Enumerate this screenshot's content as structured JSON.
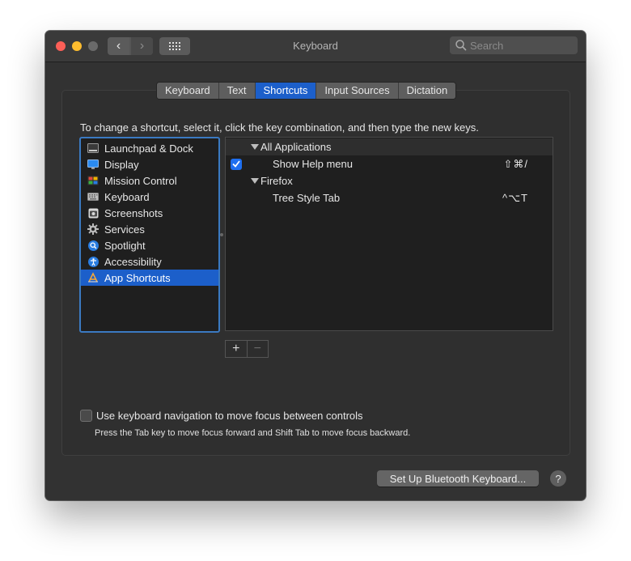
{
  "window": {
    "title": "Keyboard"
  },
  "toolbar": {
    "back_label": "‹",
    "forward_label": "›",
    "search_placeholder": "Search"
  },
  "tabs": [
    {
      "label": "Keyboard",
      "active": false
    },
    {
      "label": "Text",
      "active": false
    },
    {
      "label": "Shortcuts",
      "active": true
    },
    {
      "label": "Input Sources",
      "active": false
    },
    {
      "label": "Dictation",
      "active": false
    }
  ],
  "instruction": "To change a shortcut, select it, click the key combination, and then type the new keys.",
  "categories": [
    {
      "label": "Launchpad & Dock",
      "icon": "launchpad-dock-icon"
    },
    {
      "label": "Display",
      "icon": "display-icon"
    },
    {
      "label": "Mission Control",
      "icon": "mission-control-icon"
    },
    {
      "label": "Keyboard",
      "icon": "keyboard-icon"
    },
    {
      "label": "Screenshots",
      "icon": "screenshots-icon"
    },
    {
      "label": "Services",
      "icon": "gear-icon"
    },
    {
      "label": "Spotlight",
      "icon": "search-icon"
    },
    {
      "label": "Accessibility",
      "icon": "accessibility-icon"
    },
    {
      "label": "App Shortcuts",
      "icon": "app-store-icon",
      "selected": true
    }
  ],
  "shortcuts": {
    "groups": [
      {
        "label": "All Applications",
        "items": [
          {
            "label": "Show Help menu",
            "keys": "⇧⌘/",
            "checked": true
          }
        ]
      },
      {
        "label": "Firefox",
        "items": [
          {
            "label": "Tree Style Tab",
            "keys": "^⌥T",
            "checked": false
          }
        ]
      }
    ]
  },
  "list_controls": {
    "add_label": "+",
    "remove_label": "−"
  },
  "keyboard_navigation": {
    "label": "Use keyboard navigation to move focus between controls",
    "checked": false,
    "hint": "Press the Tab key to move focus forward and Shift Tab to move focus backward."
  },
  "bluetooth_button_label": "Set Up Bluetooth Keyboard...",
  "help_label": "?",
  "colors": {
    "accent": "#1c5fca",
    "window_bg": "#323232",
    "list_bg": "#1f1f1f",
    "focus_ring": "#3b7ac2",
    "close": "#fc5f57",
    "minimize": "#fdbc2e"
  }
}
